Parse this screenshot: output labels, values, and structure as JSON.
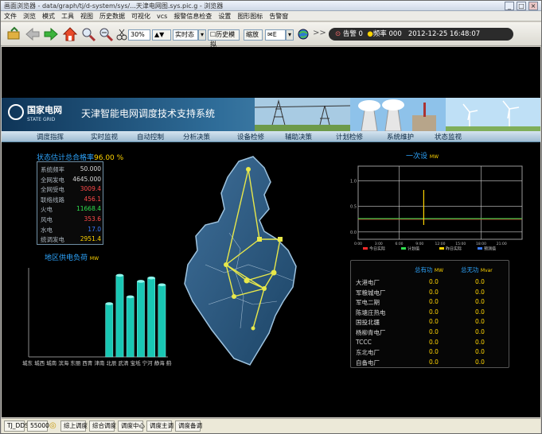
{
  "window": {
    "title": "画面浏览器 - data/graph/tj/d-system/sys/...天津电网图.sys.pic.g - 浏览器",
    "controls": [
      "_",
      "□",
      "×"
    ]
  },
  "menu": [
    "文件",
    "浏览",
    "模式",
    "工具",
    "视图",
    "历史数据",
    "可视化",
    "vcs",
    "报警信息检查",
    "设置",
    "图形图标",
    "告警窗"
  ],
  "toolbar": {
    "zoom": "30%",
    "mode": "实时态",
    "combo": "历史",
    "checkbox_label": "历史模拟",
    "btn_label": "缩放",
    "mail_label": "E",
    "alarm_count": "0",
    "freq_label": "频率",
    "freq_value": "000",
    "datetime": "2012-12-25 16:48:07",
    "alarm_label": "告警"
  },
  "banner": {
    "logo_cn": "国家电网",
    "logo_en": "STATE GRID",
    "system_title": "天津智能电网调度技术支持系统"
  },
  "nav": [
    "调度指挥",
    "实时监视",
    "自动控制",
    "分析决策",
    "设备检修",
    "辅助决策",
    "计划检修",
    "系统维护",
    "状态监视"
  ],
  "metrics": {
    "title": "状态估计总合格率",
    "rate": "96.00 %",
    "rows": [
      {
        "label": "系统频率",
        "value": "50.000",
        "color": "#d8d8d8"
      },
      {
        "label": "全网发电",
        "value": "4645.000",
        "color": "#d8d8d8"
      },
      {
        "label": "全网受电",
        "value": "3009.4",
        "color": "#ff4a4a"
      },
      {
        "label": "联络线路",
        "value": "456.1",
        "color": "#ff4a4a"
      },
      {
        "label": "火电",
        "value": "11668.4",
        "color": "#2fe04f"
      },
      {
        "label": "风电",
        "value": "353.6",
        "color": "#ff4a4a"
      },
      {
        "label": "水电",
        "value": "17.0",
        "color": "#3a7bff"
      },
      {
        "label": "统调发电",
        "value": "2951.4",
        "color": "#ffd400"
      }
    ]
  },
  "bar_panel": {
    "title": "地区供电负荷",
    "unit": "MW",
    "x_labels": "城东 城西 城南 滨海 东丽 西青 津南 北辰 武清 宝坻 宁河 静海 蓟县"
  },
  "curve_panel": {
    "title": "一次设",
    "unit": "MW",
    "y_ticks": [
      "1.0",
      "0.5",
      "0.0"
    ],
    "x_ticks": [
      "0:00",
      "3:00",
      "6:00",
      "9:00",
      "12:00",
      "15:00",
      "18:00",
      "21:00"
    ],
    "legend": [
      "今日实际",
      "计划值",
      "昨日实际",
      "预测值"
    ]
  },
  "plant_table": {
    "headers": [
      "总有功",
      "总无功"
    ],
    "header_units": [
      "MW",
      "Mvar"
    ],
    "rows": [
      {
        "name": "大港电厂",
        "p": "0.0",
        "q": "0.0"
      },
      {
        "name": "军粮城电厂",
        "p": "0.0",
        "q": "0.0"
      },
      {
        "name": "军电二期",
        "p": "0.0",
        "q": "0.0"
      },
      {
        "name": "陈塘庄热电",
        "p": "0.0",
        "q": "0.0"
      },
      {
        "name": "国投北疆",
        "p": "0.0",
        "q": "0.0"
      },
      {
        "name": "杨柳青电厂",
        "p": "0.0",
        "q": "0.0"
      },
      {
        "name": "TCCC",
        "p": "0.0",
        "q": "0.0"
      },
      {
        "name": "东北电厂",
        "p": "0.0",
        "q": "0.0"
      },
      {
        "name": "自备电厂",
        "p": "0.0",
        "q": "0.0"
      }
    ]
  },
  "status": {
    "user": "TJ_DDS",
    "code": "55000",
    "items": [
      "综上调度",
      "综合调度",
      "调度中心",
      "调度主调",
      "调度备调"
    ]
  },
  "chart_data": [
    {
      "type": "bar",
      "title": "地区供电负荷",
      "categories": [
        "城东",
        "城西",
        "城南",
        "滨海",
        "东丽",
        "西青",
        "津南",
        "北辰",
        "武清",
        "宝坻",
        "宁河",
        "静海",
        "蓟县"
      ],
      "values": [
        0,
        0,
        0,
        0,
        0,
        0,
        0,
        62,
        95,
        70,
        88,
        92,
        84
      ],
      "ylim": [
        0,
        100
      ]
    },
    {
      "type": "line",
      "title": "一次设",
      "x": [
        "0:00",
        "3:00",
        "6:00",
        "9:00",
        "12:00",
        "15:00",
        "18:00",
        "21:00",
        "24:00"
      ],
      "series": [
        {
          "name": "今日实际",
          "color": "#ff2a2a",
          "values": [
            0.25,
            0.25,
            0.25,
            0.25,
            0.25,
            0.25,
            0.25,
            0.25,
            0.25
          ]
        },
        {
          "name": "计划值",
          "color": "#2fe04f",
          "values": [
            0.26,
            0.26,
            0.26,
            0.26,
            0.26,
            0.26,
            0.26,
            0.26,
            0.26
          ]
        },
        {
          "name": "昨日实际",
          "color": "#ffd400",
          "values": [
            null,
            null,
            null,
            null,
            null,
            null,
            null,
            null,
            null
          ]
        },
        {
          "name": "预测值",
          "color": "#3a7bff",
          "values": [
            null,
            null,
            null,
            null,
            null,
            null,
            null,
            null,
            null
          ]
        }
      ],
      "ylim": [
        0,
        1
      ]
    }
  ]
}
